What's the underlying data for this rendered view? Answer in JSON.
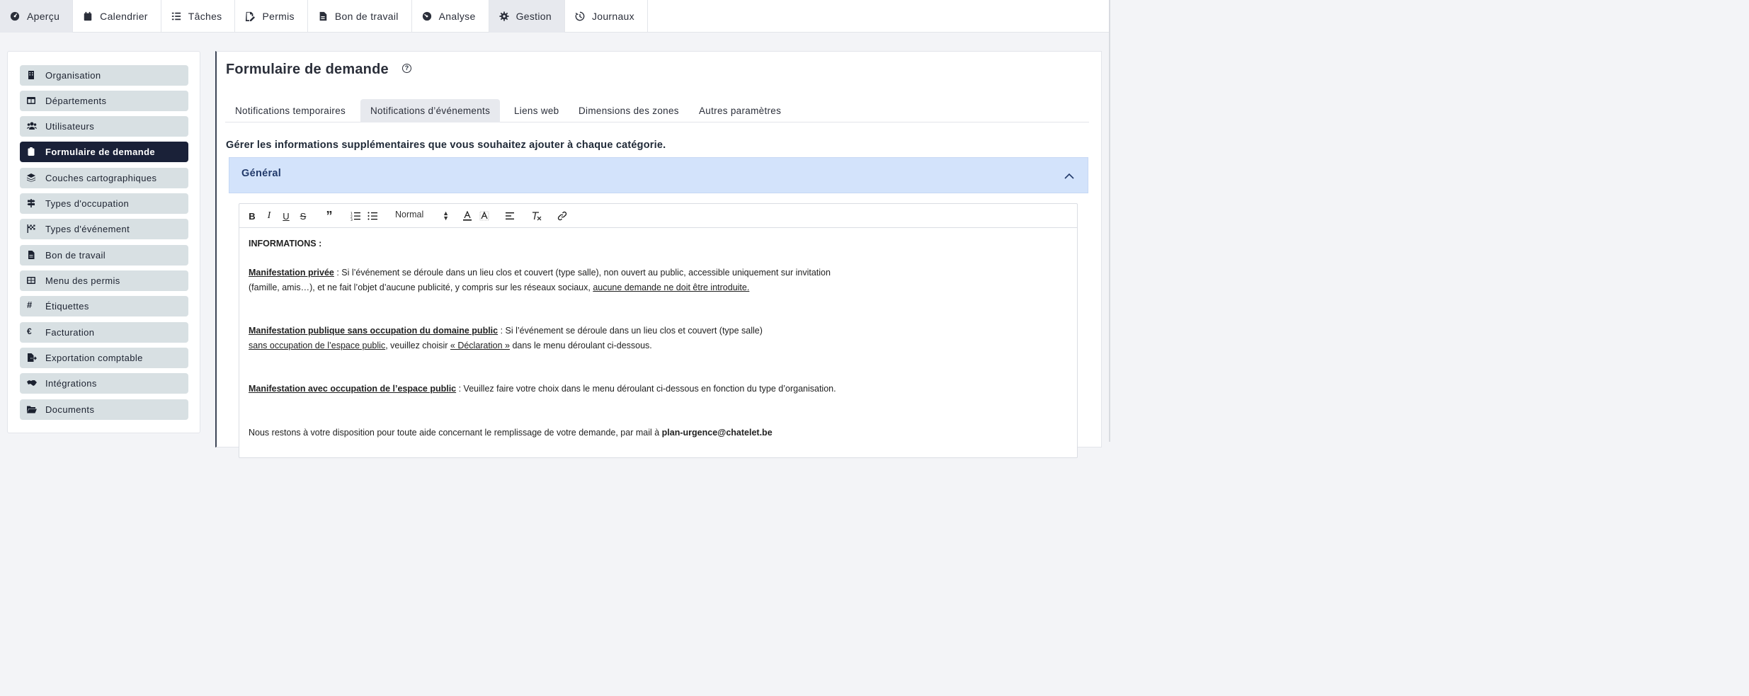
{
  "topnav": {
    "tabs": [
      {
        "label": "Aperçu",
        "icon": "dashboard-icon",
        "active": true
      },
      {
        "label": "Calendrier",
        "icon": "calendar-icon",
        "active": false
      },
      {
        "label": "Tâches",
        "icon": "tasks-icon",
        "active": false
      },
      {
        "label": "Permis",
        "icon": "permit-icon",
        "active": false
      },
      {
        "label": "Bon de travail",
        "icon": "work-order-icon",
        "active": false
      },
      {
        "label": "Analyse",
        "icon": "analysis-icon",
        "active": false
      },
      {
        "label": "Gestion",
        "icon": "gear-icon",
        "active": true
      },
      {
        "label": "Journaux",
        "icon": "history-icon",
        "active": false
      }
    ]
  },
  "sidebar": {
    "items": [
      {
        "label": "Organisation",
        "icon": "building-icon"
      },
      {
        "label": "Départements",
        "icon": "table-icon"
      },
      {
        "label": "Utilisateurs",
        "icon": "users-icon"
      },
      {
        "label": "Formulaire de demande",
        "icon": "clipboard-icon",
        "active": true
      },
      {
        "label": "Couches cartographiques",
        "icon": "layers-icon"
      },
      {
        "label": "Types d'occupation",
        "icon": "signs-icon"
      },
      {
        "label": "Types d'événement",
        "icon": "flag-icon"
      },
      {
        "label": "Bon de travail",
        "icon": "file-icon"
      },
      {
        "label": "Menu des permis",
        "icon": "grid-icon"
      },
      {
        "label": "Étiquettes",
        "icon": "hashtag-icon"
      },
      {
        "label": "Facturation",
        "icon": "euro-icon"
      },
      {
        "label": "Exportation comptable",
        "icon": "file-export-icon"
      },
      {
        "label": "Intégrations",
        "icon": "handshake-icon"
      },
      {
        "label": "Documents",
        "icon": "folder-icon"
      }
    ]
  },
  "main": {
    "title": "Formulaire de demande",
    "subtabs": [
      {
        "label": "Notifications temporaires",
        "active": false
      },
      {
        "label": "Notifications d’événements",
        "active": true
      },
      {
        "label": "Liens web",
        "active": false
      },
      {
        "label": "Dimensions des zones",
        "active": false
      },
      {
        "label": "Autres paramètres",
        "active": false
      }
    ],
    "section_description": "Gérer les informations supplémentaires que vous souhaitez ajouter à chaque catégorie.",
    "accordion_title": "Général",
    "editor": {
      "format_select": "Normal",
      "heading": "INFORMATIONS :",
      "p1_title": "Manifestation privée",
      "p1_text_a": " : Si l’événement se déroule dans un lieu clos et couvert (type salle), non ouvert au public, accessible uniquement sur invitation",
      "p1_text_b": "(famille, amis…), et ne fait l’objet d’aucune publicité, y compris sur les réseaux sociaux, ",
      "p1_underline": "aucune demande ne doit être introduite.",
      "p2_title": "Manifestation publique sans occupation du domaine public",
      "p2_text_a": " : Si l’événement se déroule dans un lieu clos et couvert (type salle)",
      "p2_underline_a": "sans occupation de l’espace public",
      "p2_text_b": ", veuillez choisir ",
      "p2_underline_b": "« Déclaration »",
      "p2_text_c": " dans le menu déroulant ci-dessous.",
      "p3_title": "Manifestation avec occupation de l’espace public",
      "p3_text": " : Veuillez faire votre choix dans le menu déroulant ci-dessous en fonction du type d’organisation.",
      "p4_text": "Nous restons à votre disposition pour toute aide concernant le remplissage de votre demande, par mail à ",
      "p4_email": "plan-urgence@chatelet.be"
    }
  }
}
